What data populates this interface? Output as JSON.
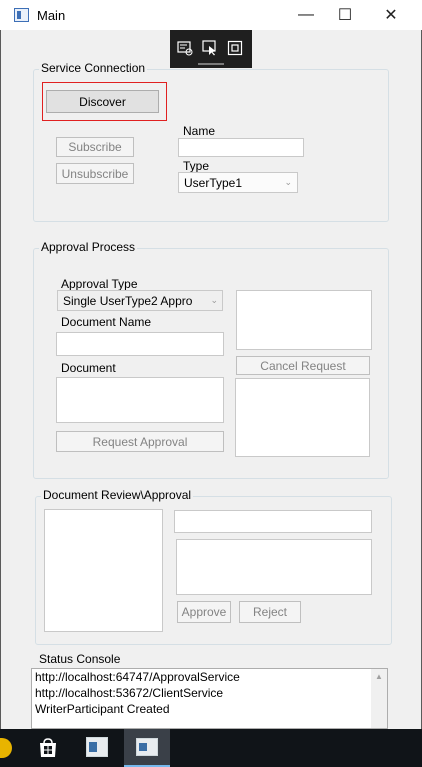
{
  "window": {
    "title": "Main"
  },
  "titlebar": {
    "minimize": "—",
    "maximize": "☐",
    "close": "✕"
  },
  "service_connection": {
    "group_label": "Service Connection",
    "discover_label": "Discover",
    "subscribe_label": "Subscribe",
    "unsubscribe_label": "Unsubscribe",
    "name_label": "Name",
    "name_value": "",
    "type_label": "Type",
    "type_value": "UserType1"
  },
  "approval_process": {
    "group_label": "Approval Process",
    "approval_type_label": "Approval Type",
    "approval_type_value": "Single UserType2 Appro",
    "document_name_label": "Document Name",
    "document_name_value": "",
    "document_label": "Document",
    "document_value": "",
    "request_approval_label": "Request Approval",
    "cancel_request_label": "Cancel Request"
  },
  "document_review": {
    "group_label": "Document Review\\Approval",
    "approve_label": "Approve",
    "reject_label": "Reject"
  },
  "status_console": {
    "label": "Status Console",
    "lines": [
      "http://localhost:64747/ApprovalService",
      "http://localhost:53672/ClientService",
      "WriterParticipant Created"
    ]
  },
  "colors": {
    "accent_red": "#e02020",
    "taskbar": "#101418"
  }
}
